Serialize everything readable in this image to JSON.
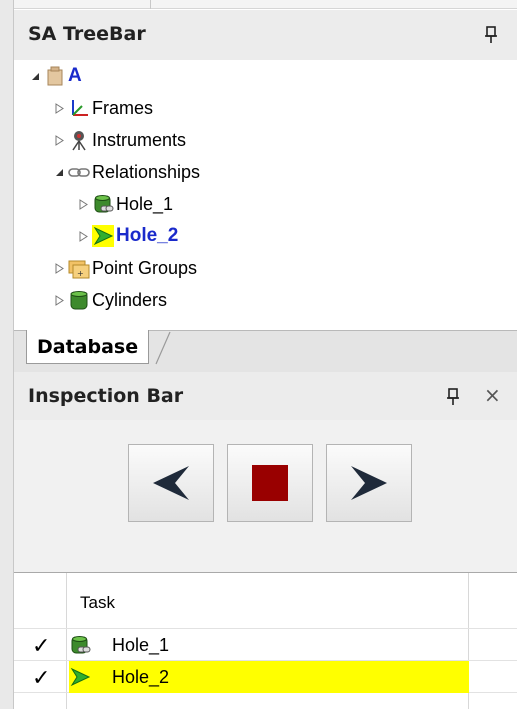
{
  "treebar": {
    "title": "SA TreeBar",
    "root": {
      "label": "A",
      "expanded": true,
      "icon": "box-icon"
    },
    "items": [
      {
        "label": "Frames",
        "icon": "frames-icon",
        "expanded": false
      },
      {
        "label": "Instruments",
        "icon": "instrument-icon",
        "expanded": false
      },
      {
        "label": "Relationships",
        "icon": "chain-link-icon",
        "expanded": true,
        "children": [
          {
            "label": "Hole_1",
            "icon": "cylinder-link-icon",
            "selected": false
          },
          {
            "label": "Hole_2",
            "icon": "green-arrow-icon",
            "selected": true
          }
        ]
      },
      {
        "label": "Point Groups",
        "icon": "folder-points-icon",
        "expanded": false
      },
      {
        "label": "Cylinders",
        "icon": "cylinder-icon",
        "expanded": false
      }
    ],
    "tab_label": "Database"
  },
  "inspection": {
    "title": "Inspection Bar",
    "buttons": [
      {
        "name": "previous",
        "icon": "left-arrow-icon"
      },
      {
        "name": "stop",
        "icon": "stop-square-icon"
      },
      {
        "name": "next",
        "icon": "right-arrow-icon"
      }
    ],
    "grid": {
      "column_header": "Task",
      "rows": [
        {
          "label": "Hole_1",
          "checked": true,
          "icon": "cylinder-link-icon",
          "highlighted": false
        },
        {
          "label": "Hole_2",
          "checked": true,
          "icon": "green-arrow-icon",
          "highlighted": true
        }
      ]
    }
  },
  "colors": {
    "selected_text": "#1a2acb",
    "highlight": "#ffff00",
    "stop_red": "#990000",
    "arrow_navy": "#1f2a3a"
  }
}
